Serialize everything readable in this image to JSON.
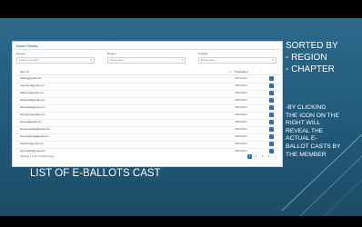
{
  "panel": {
    "title": "Ballot Details",
    "filters": [
      {
        "label": "Session",
        "value": "session year 2023"
      },
      {
        "label": "Region",
        "value": "Please select"
      },
      {
        "label": "Chapter",
        "value": "Please select"
      }
    ],
    "columns": {
      "email": "Sent To",
      "date": "Timestamp"
    },
    "rows": [
      {
        "email": "lsterlng@gmail.com",
        "date": "03/03/2023"
      },
      {
        "email": "mjohnson@gmail.com",
        "date": "03/03/2023"
      },
      {
        "email": "rdelacruz@gmail.com",
        "date": "03/03/2023"
      },
      {
        "email": "hfernando@gmail.com",
        "date": "03/03/2023"
      },
      {
        "email": "dbenavida@gmail.com",
        "date": "03/03/2023"
      },
      {
        "email": "cfrancisco@gmail.com",
        "date": "03/03/2023"
      },
      {
        "email": "acarino@gmail.com",
        "date": "03/03/2023"
      },
      {
        "email": "dcontrerasdiaz@gmail.com",
        "date": "03/03/2023"
      },
      {
        "email": "rtomanarezza@gmail.com",
        "date": "03/03/2023"
      },
      {
        "email": "rtolentino@gmail.com",
        "date": "03/03/2023"
      },
      {
        "email": "jsynnmabc@gmail.com",
        "date": "03/03/2023"
      }
    ],
    "summary": "Showing 1 to 10 of 1,000 entries",
    "pages": [
      "‹",
      "1",
      "2",
      "3",
      "4",
      "›"
    ]
  },
  "side_heading": [
    "SORTED BY",
    "-  REGION",
    "-  CHAPTER"
  ],
  "side_body": [
    "-BY CLICKING",
    "THE ICON ON THE",
    "RIGHT WILL",
    "REVEAL THE",
    "ACTUAL E-",
    "BALLOT CASTS BY",
    "THE MEMBER"
  ],
  "main_title": "LIST OF E-BALLOTS CAST",
  "player_icons": [
    "play-icon",
    "volume-icon",
    "settings-icon"
  ]
}
